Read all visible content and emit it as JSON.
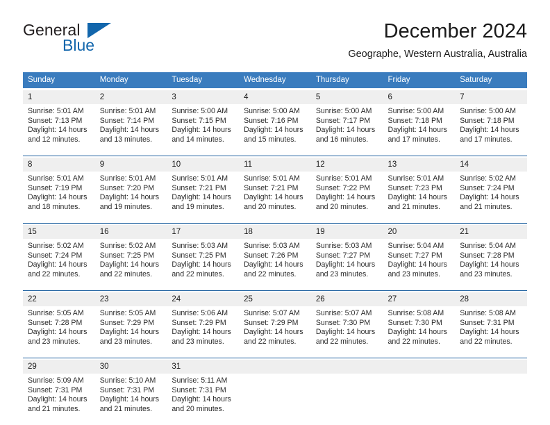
{
  "brand": {
    "name_part1": "General",
    "name_part2": "Blue",
    "flag_icon": "triangle-flag-icon"
  },
  "header": {
    "title": "December 2024",
    "subtitle": "Geographe, Western Australia, Australia"
  },
  "colors": {
    "header_blue": "#3a7cbe",
    "separator_blue": "#1b5e9e",
    "daynum_gray": "#efefef",
    "brand_blue": "#1266ac",
    "text": "#1a1a1a"
  },
  "weekday_headers": [
    "Sunday",
    "Monday",
    "Tuesday",
    "Wednesday",
    "Thursday",
    "Friday",
    "Saturday"
  ],
  "weeks": [
    [
      {
        "day": "1",
        "sunrise": "Sunrise: 5:01 AM",
        "sunset": "Sunset: 7:13 PM",
        "daylight1": "Daylight: 14 hours",
        "daylight2": "and 12 minutes."
      },
      {
        "day": "2",
        "sunrise": "Sunrise: 5:01 AM",
        "sunset": "Sunset: 7:14 PM",
        "daylight1": "Daylight: 14 hours",
        "daylight2": "and 13 minutes."
      },
      {
        "day": "3",
        "sunrise": "Sunrise: 5:00 AM",
        "sunset": "Sunset: 7:15 PM",
        "daylight1": "Daylight: 14 hours",
        "daylight2": "and 14 minutes."
      },
      {
        "day": "4",
        "sunrise": "Sunrise: 5:00 AM",
        "sunset": "Sunset: 7:16 PM",
        "daylight1": "Daylight: 14 hours",
        "daylight2": "and 15 minutes."
      },
      {
        "day": "5",
        "sunrise": "Sunrise: 5:00 AM",
        "sunset": "Sunset: 7:17 PM",
        "daylight1": "Daylight: 14 hours",
        "daylight2": "and 16 minutes."
      },
      {
        "day": "6",
        "sunrise": "Sunrise: 5:00 AM",
        "sunset": "Sunset: 7:18 PM",
        "daylight1": "Daylight: 14 hours",
        "daylight2": "and 17 minutes."
      },
      {
        "day": "7",
        "sunrise": "Sunrise: 5:00 AM",
        "sunset": "Sunset: 7:18 PM",
        "daylight1": "Daylight: 14 hours",
        "daylight2": "and 17 minutes."
      }
    ],
    [
      {
        "day": "8",
        "sunrise": "Sunrise: 5:01 AM",
        "sunset": "Sunset: 7:19 PM",
        "daylight1": "Daylight: 14 hours",
        "daylight2": "and 18 minutes."
      },
      {
        "day": "9",
        "sunrise": "Sunrise: 5:01 AM",
        "sunset": "Sunset: 7:20 PM",
        "daylight1": "Daylight: 14 hours",
        "daylight2": "and 19 minutes."
      },
      {
        "day": "10",
        "sunrise": "Sunrise: 5:01 AM",
        "sunset": "Sunset: 7:21 PM",
        "daylight1": "Daylight: 14 hours",
        "daylight2": "and 19 minutes."
      },
      {
        "day": "11",
        "sunrise": "Sunrise: 5:01 AM",
        "sunset": "Sunset: 7:21 PM",
        "daylight1": "Daylight: 14 hours",
        "daylight2": "and 20 minutes."
      },
      {
        "day": "12",
        "sunrise": "Sunrise: 5:01 AM",
        "sunset": "Sunset: 7:22 PM",
        "daylight1": "Daylight: 14 hours",
        "daylight2": "and 20 minutes."
      },
      {
        "day": "13",
        "sunrise": "Sunrise: 5:01 AM",
        "sunset": "Sunset: 7:23 PM",
        "daylight1": "Daylight: 14 hours",
        "daylight2": "and 21 minutes."
      },
      {
        "day": "14",
        "sunrise": "Sunrise: 5:02 AM",
        "sunset": "Sunset: 7:24 PM",
        "daylight1": "Daylight: 14 hours",
        "daylight2": "and 21 minutes."
      }
    ],
    [
      {
        "day": "15",
        "sunrise": "Sunrise: 5:02 AM",
        "sunset": "Sunset: 7:24 PM",
        "daylight1": "Daylight: 14 hours",
        "daylight2": "and 22 minutes."
      },
      {
        "day": "16",
        "sunrise": "Sunrise: 5:02 AM",
        "sunset": "Sunset: 7:25 PM",
        "daylight1": "Daylight: 14 hours",
        "daylight2": "and 22 minutes."
      },
      {
        "day": "17",
        "sunrise": "Sunrise: 5:03 AM",
        "sunset": "Sunset: 7:25 PM",
        "daylight1": "Daylight: 14 hours",
        "daylight2": "and 22 minutes."
      },
      {
        "day": "18",
        "sunrise": "Sunrise: 5:03 AM",
        "sunset": "Sunset: 7:26 PM",
        "daylight1": "Daylight: 14 hours",
        "daylight2": "and 22 minutes."
      },
      {
        "day": "19",
        "sunrise": "Sunrise: 5:03 AM",
        "sunset": "Sunset: 7:27 PM",
        "daylight1": "Daylight: 14 hours",
        "daylight2": "and 23 minutes."
      },
      {
        "day": "20",
        "sunrise": "Sunrise: 5:04 AM",
        "sunset": "Sunset: 7:27 PM",
        "daylight1": "Daylight: 14 hours",
        "daylight2": "and 23 minutes."
      },
      {
        "day": "21",
        "sunrise": "Sunrise: 5:04 AM",
        "sunset": "Sunset: 7:28 PM",
        "daylight1": "Daylight: 14 hours",
        "daylight2": "and 23 minutes."
      }
    ],
    [
      {
        "day": "22",
        "sunrise": "Sunrise: 5:05 AM",
        "sunset": "Sunset: 7:28 PM",
        "daylight1": "Daylight: 14 hours",
        "daylight2": "and 23 minutes."
      },
      {
        "day": "23",
        "sunrise": "Sunrise: 5:05 AM",
        "sunset": "Sunset: 7:29 PM",
        "daylight1": "Daylight: 14 hours",
        "daylight2": "and 23 minutes."
      },
      {
        "day": "24",
        "sunrise": "Sunrise: 5:06 AM",
        "sunset": "Sunset: 7:29 PM",
        "daylight1": "Daylight: 14 hours",
        "daylight2": "and 23 minutes."
      },
      {
        "day": "25",
        "sunrise": "Sunrise: 5:07 AM",
        "sunset": "Sunset: 7:29 PM",
        "daylight1": "Daylight: 14 hours",
        "daylight2": "and 22 minutes."
      },
      {
        "day": "26",
        "sunrise": "Sunrise: 5:07 AM",
        "sunset": "Sunset: 7:30 PM",
        "daylight1": "Daylight: 14 hours",
        "daylight2": "and 22 minutes."
      },
      {
        "day": "27",
        "sunrise": "Sunrise: 5:08 AM",
        "sunset": "Sunset: 7:30 PM",
        "daylight1": "Daylight: 14 hours",
        "daylight2": "and 22 minutes."
      },
      {
        "day": "28",
        "sunrise": "Sunrise: 5:08 AM",
        "sunset": "Sunset: 7:31 PM",
        "daylight1": "Daylight: 14 hours",
        "daylight2": "and 22 minutes."
      }
    ],
    [
      {
        "day": "29",
        "sunrise": "Sunrise: 5:09 AM",
        "sunset": "Sunset: 7:31 PM",
        "daylight1": "Daylight: 14 hours",
        "daylight2": "and 21 minutes."
      },
      {
        "day": "30",
        "sunrise": "Sunrise: 5:10 AM",
        "sunset": "Sunset: 7:31 PM",
        "daylight1": "Daylight: 14 hours",
        "daylight2": "and 21 minutes."
      },
      {
        "day": "31",
        "sunrise": "Sunrise: 5:11 AM",
        "sunset": "Sunset: 7:31 PM",
        "daylight1": "Daylight: 14 hours",
        "daylight2": "and 20 minutes."
      },
      {
        "day": "",
        "sunrise": "",
        "sunset": "",
        "daylight1": "",
        "daylight2": ""
      },
      {
        "day": "",
        "sunrise": "",
        "sunset": "",
        "daylight1": "",
        "daylight2": ""
      },
      {
        "day": "",
        "sunrise": "",
        "sunset": "",
        "daylight1": "",
        "daylight2": ""
      },
      {
        "day": "",
        "sunrise": "",
        "sunset": "",
        "daylight1": "",
        "daylight2": ""
      }
    ]
  ]
}
